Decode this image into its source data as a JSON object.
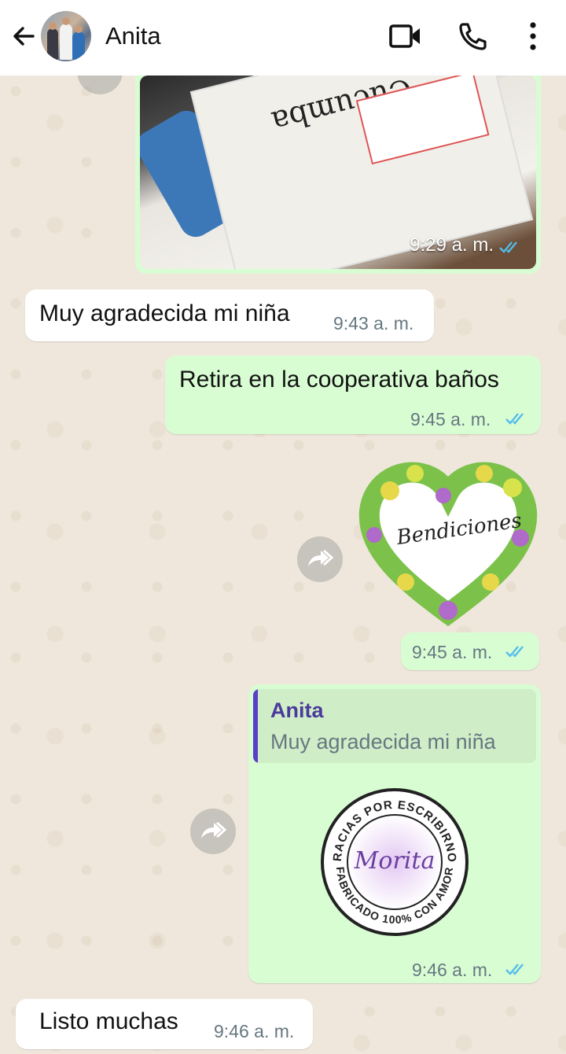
{
  "header": {
    "contact_name": "Anita",
    "back_icon": "arrow-left-icon",
    "video_icon": "video-call-icon",
    "call_icon": "phone-icon",
    "menu_icon": "more-vertical-icon"
  },
  "messages": [
    {
      "type": "image",
      "direction": "out",
      "time": "9:29 a. m.",
      "status": "read"
    },
    {
      "type": "text",
      "direction": "in",
      "text": "Muy agradecida mi niña",
      "time": "9:43 a. m."
    },
    {
      "type": "text",
      "direction": "out",
      "text": "Retira en la cooperativa baños",
      "time": "9:45 a. m.",
      "status": "read"
    },
    {
      "type": "sticker",
      "direction": "out",
      "sticker_text": "Bendiciones",
      "time": "9:45 a. m.",
      "status": "read"
    },
    {
      "type": "reply-sticker",
      "direction": "out",
      "reply_to_name": "Anita",
      "reply_to_text": "Muy agradecida mi niña",
      "stamp_top": "GRACIAS POR ESCRIBIRNOS",
      "stamp_center": "Morita",
      "stamp_bottom": "FABRICADO 100% CON AMOR",
      "time": "9:46 a. m.",
      "status": "read"
    },
    {
      "type": "text",
      "direction": "in",
      "text": "Listo muchas",
      "time": "9:46 a. m."
    }
  ],
  "colors": {
    "outgoing_bubble": "#d9fdd3",
    "incoming_bubble": "#ffffff",
    "read_tick": "#53bdeb",
    "reply_accent": "#5b3fc4"
  }
}
